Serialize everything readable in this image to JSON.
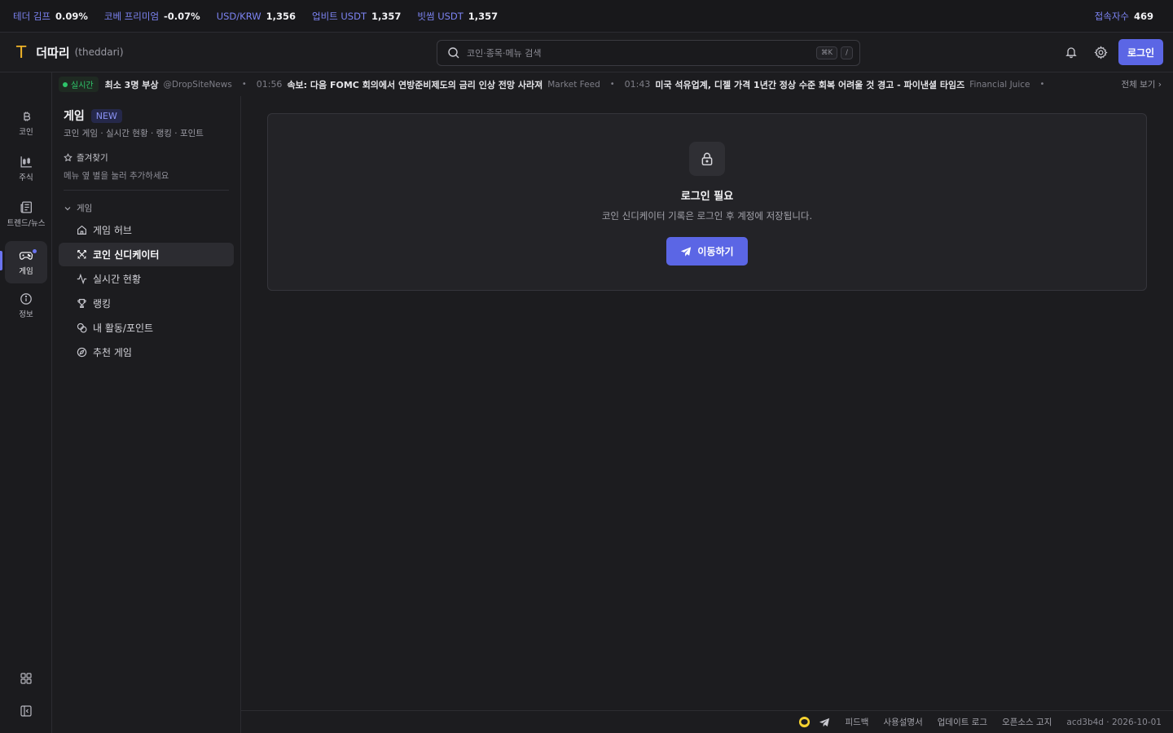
{
  "ticker": {
    "items": [
      {
        "label": "테더 김프",
        "value": "0.09%"
      },
      {
        "label": "코베 프리미엄",
        "value": "-0.07%"
      },
      {
        "label": "USD/KRW",
        "value": "1,356"
      },
      {
        "label": "업비트 USDT",
        "value": "1,357"
      },
      {
        "label": "빗썸 USDT",
        "value": "1,357"
      }
    ],
    "visitors_label": "접속자수",
    "visitors_value": "469"
  },
  "header": {
    "logo": "T",
    "brand": "더따리",
    "brand_sub": "(theddari)",
    "search_placeholder": "코인·종목·메뉴 검색",
    "search_kbd_1": "⌘K",
    "search_kbd_2": "/",
    "login_label": "로그인",
    "icons": [
      "bell-icon",
      "gear-icon"
    ]
  },
  "rail": {
    "items": [
      {
        "label": "코인",
        "icon": "bitcoin-icon"
      },
      {
        "label": "주식",
        "icon": "candle-chart-icon"
      },
      {
        "label": "트렌드/뉴스",
        "icon": "newspaper-icon"
      },
      {
        "label": "게임",
        "icon": "gamepad-icon",
        "active": true
      },
      {
        "label": "정보",
        "icon": "info-icon"
      }
    ],
    "bottom_icons": [
      "grid-icon",
      "sidebar-collapse-icon"
    ]
  },
  "news": {
    "live_label": "실시간",
    "items": [
      {
        "time": "",
        "text": "최소 3명 부상",
        "source": "@DropSiteNews"
      },
      {
        "time": "01:56",
        "text": "속보: 다음 FOMC 회의에서 연방준비제도의 금리 인상 전망 사라져",
        "source": "Market Feed"
      },
      {
        "time": "01:43",
        "text": "미국 석유업계, 디젤 가격 1년간 정상 수준 회복 어려울 것 경고 - 파이낸셜 타임즈",
        "source": "Financial Juice"
      }
    ],
    "view_all": "전체 보기 ›"
  },
  "panel": {
    "title": "게임",
    "badge": "NEW",
    "subtitle": "코인 게임 · 실시간 현황 · 랭킹 · 포인트",
    "favorites_title": "즐겨찾기",
    "favorites_hint": "메뉴 옆 별을 눌러 추가하세요",
    "group_label": "게임",
    "menu": [
      {
        "label": "게임 허브",
        "icon": "home-icon"
      },
      {
        "label": "코인 신디케이터",
        "icon": "crossed-swords-icon",
        "active": true
      },
      {
        "label": "실시간 현황",
        "icon": "activity-icon"
      },
      {
        "label": "랭킹",
        "icon": "trophy-icon"
      },
      {
        "label": "내 활동/포인트",
        "icon": "coins-icon"
      },
      {
        "label": "추천 게임",
        "icon": "compass-icon"
      }
    ]
  },
  "main": {
    "title": "로그인 필요",
    "description": "코인 신디케이터 기록은 로그인 후 계정에 저장됩니다.",
    "button_label": "이동하기"
  },
  "footer": {
    "links": [
      "피드백",
      "사용설명서",
      "업데이트 로그",
      "오픈소스 고지"
    ],
    "version": "acd3b4d · 2026-10-01",
    "icons": [
      "kakaotalk-icon",
      "telegram-icon"
    ]
  },
  "colors": {
    "accent": "#5b66e5",
    "live_green": "#2ec56a",
    "logo_yellow": "#f0b429",
    "background": "#1c1c1f"
  }
}
